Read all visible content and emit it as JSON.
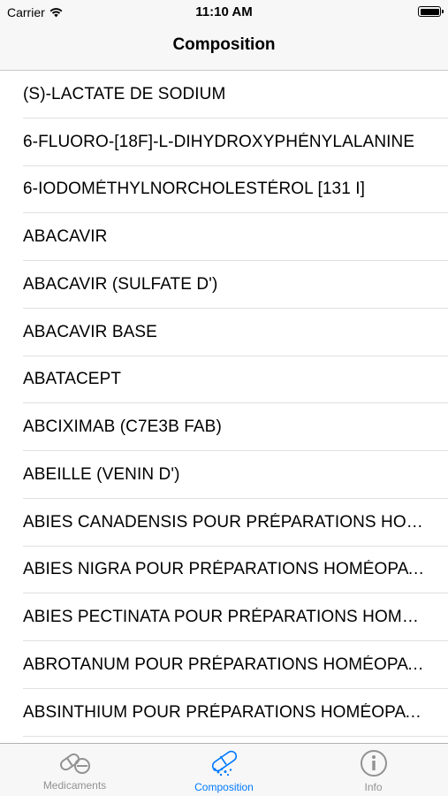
{
  "status_bar": {
    "carrier": "Carrier",
    "time": "11:10 AM"
  },
  "nav": {
    "title": "Composition"
  },
  "list": {
    "items": [
      "(S)-LACTATE DE SODIUM",
      "6-FLUORO-[18F]-L-DIHYDROXYPHÉNYLALANINE",
      "6-IODOMÉTHYLNORCHOLESTÉROL [131 I]",
      "ABACAVIR",
      "ABACAVIR (SULFATE D')",
      "ABACAVIR BASE",
      "ABATACEPT",
      "ABCIXIMAB (C7E3B FAB)",
      "ABEILLE (VENIN D')",
      "ABIES CANADENSIS POUR PRÉPARATIONS HOMÉOPATHIQUES",
      "ABIES NIGRA POUR PRÉPARATIONS HOMÉOPATHIQUES",
      "ABIES PECTINATA POUR PRÉPARATIONS HOMÉOPATHIQUES",
      "ABROTANUM POUR PRÉPARATIONS HOMÉOPATHIQUES",
      "ABSINTHIUM POUR PRÉPARATIONS HOMÉOPATHIQUES"
    ]
  },
  "tabs": [
    {
      "label": "Medicaments",
      "icon": "pills-icon",
      "active": false
    },
    {
      "label": "Composition",
      "icon": "capsule-icon",
      "active": true
    },
    {
      "label": "Info",
      "icon": "info-icon",
      "active": false
    }
  ],
  "colors": {
    "accent": "#007aff",
    "inactive": "#929292"
  }
}
